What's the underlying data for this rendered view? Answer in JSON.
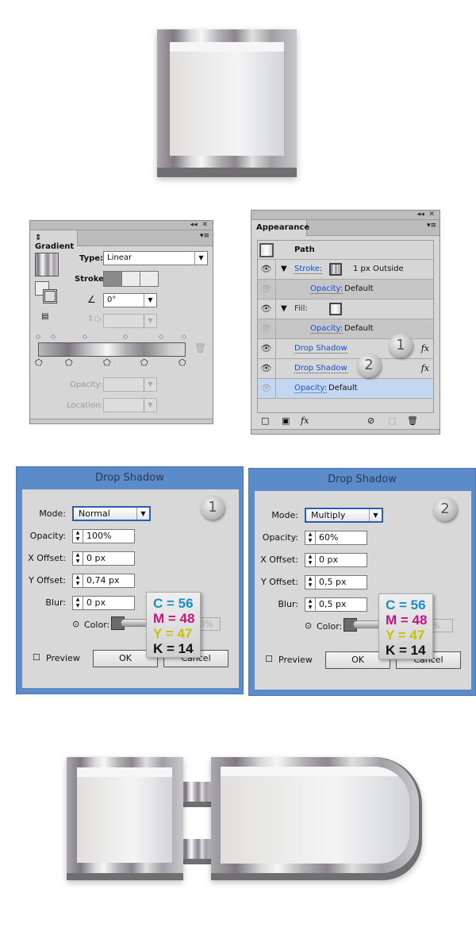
{
  "gradient_panel": {
    "title": "Gradient",
    "type_label": "Type:",
    "type_value": "Linear",
    "stroke_label": "Stroke:",
    "angle_value": "0°",
    "opacity_label": "Opacity:",
    "location_label": "Location:",
    "collapse": "◂◂",
    "close": "✕",
    "menu": "▾≡"
  },
  "appearance_panel": {
    "title": "Appearance",
    "collapse": "◂◂",
    "close": "✕",
    "menu": "▾≡",
    "path_label": "Path",
    "stroke_label": "Stroke:",
    "stroke_value": "1 px  Outside",
    "opacity_label": "Opacity:",
    "default": "Default",
    "fill_label": "Fill:",
    "effects": [
      {
        "label": "Drop Shadow",
        "badge": "1"
      },
      {
        "label": "Drop Shadow",
        "badge": "2"
      }
    ],
    "fx": "fx"
  },
  "dialogs": [
    {
      "title": "Drop Shadow",
      "badge": "1",
      "mode_label": "Mode:",
      "mode": "Normal",
      "opacity_label": "Opacity:",
      "opacity": "100%",
      "x_label": "X Offset:",
      "x": "0 px",
      "y_label": "Y Offset:",
      "y": "0,74 px",
      "blur_label": "Blur:",
      "blur": "0 px",
      "color_label": "Color:",
      "darkness": "0%",
      "preview": "Preview",
      "ok": "OK",
      "cancel": "Cancel",
      "c": "C = 56",
      "m": "M = 48",
      "yy": "Y = 47",
      "k": "K = 14"
    },
    {
      "title": "Drop Shadow",
      "badge": "2",
      "mode_label": "Mode:",
      "mode": "Multiply",
      "opacity_label": "Opacity:",
      "opacity": "60%",
      "x_label": "X Offset:",
      "x": "0 px",
      "y_label": "Y Offset:",
      "y": "0,5 px",
      "blur_label": "Blur:",
      "blur": "0,5 px",
      "color_label": "Color:",
      "darkness": "%",
      "preview": "Preview",
      "ok": "OK",
      "cancel": "Cancel",
      "c": "C = 56",
      "m": "M = 48",
      "yy": "Y = 47",
      "k": "K = 14"
    }
  ],
  "colors": {
    "cyan": "#1a8fc0",
    "magenta": "#c4167e",
    "yellow": "#c9c200",
    "black": "#111111",
    "dialog_frame": "#5b8bc9",
    "selected_row": "#c3d6f2"
  }
}
